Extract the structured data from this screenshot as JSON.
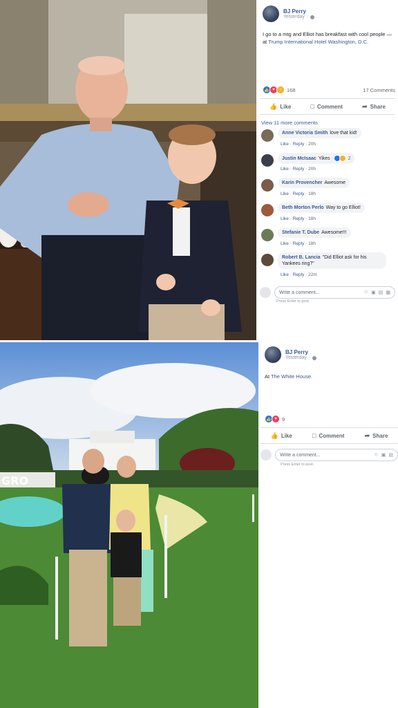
{
  "post1": {
    "author": "BJ Perry",
    "time": "Yesterday",
    "text_main": "I go to a mtg and Elliot has breakfast with cool people",
    "text_at": " — at ",
    "location": "Trump International Hotel Washington, D.C.",
    "reaction_count": "168",
    "comment_count": "17 Comments",
    "actions": {
      "like": "Like",
      "comment": "Comment",
      "share": "Share"
    },
    "view_more": "View 11 more comments",
    "comments": [
      {
        "name": "Anne Victoria Smith",
        "text": "love that kid!",
        "time": "20h",
        "color": "#7a6a58"
      },
      {
        "name": "Justin McIsaac",
        "text": "Yikes",
        "reactions": "2",
        "time": "20h",
        "color": "#3c3f48"
      },
      {
        "name": "Karin Provencher",
        "text": "Awesome",
        "time": "18h",
        "color": "#7a5d48"
      },
      {
        "name": "Beth Morton Perlo",
        "text": "Way to go Elliot!",
        "time": "18h",
        "color": "#9b5a3c"
      },
      {
        "name": "Stefanie T. Dube",
        "text": "Awesome!!!",
        "time": "18h",
        "color": "#6b7a58"
      },
      {
        "name": "Robert B. Lancia",
        "text": "\"Did Elliot ask for his Yankees ring?\"",
        "time": "22m",
        "color": "#5d4a3a"
      }
    ],
    "comment_like": "Like",
    "comment_reply": "Reply",
    "write_placeholder": "Write a comment...",
    "enter_hint": "Press Enter to post."
  },
  "post2": {
    "author": "BJ Perry",
    "time": "Yesterday",
    "text_at": "At ",
    "location": "The White House.",
    "reaction_count": "9",
    "actions": {
      "like": "Like",
      "comment": "Comment",
      "share": "Share"
    },
    "write_placeholder": "Write a comment...",
    "enter_hint": "Press Enter to post.",
    "sign_text": "GRO"
  }
}
